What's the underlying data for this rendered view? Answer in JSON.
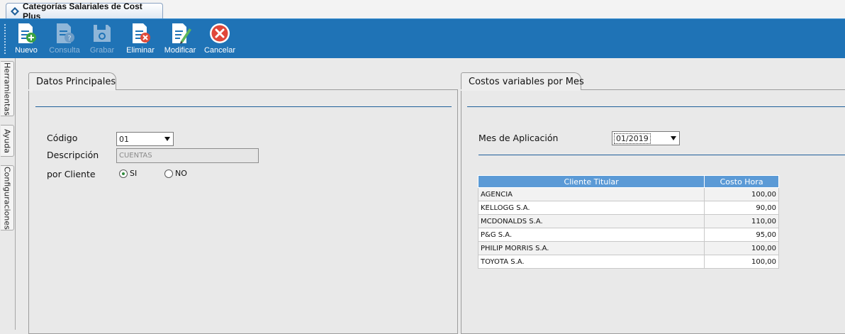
{
  "window_tab": {
    "title": "Categorías Salariales de Cost Plus"
  },
  "toolbar": {
    "buttons": [
      {
        "label": "Nuevo",
        "icon": "document-add-icon",
        "enabled": true
      },
      {
        "label": "Consulta",
        "icon": "document-query-icon",
        "enabled": false
      },
      {
        "label": "Grabar",
        "icon": "save-disk-icon",
        "enabled": false
      },
      {
        "label": "Eliminar",
        "icon": "document-delete-icon",
        "enabled": true
      },
      {
        "label": "Modificar",
        "icon": "document-edit-icon",
        "enabled": true
      },
      {
        "label": "Cancelar",
        "icon": "cancel-circle-icon",
        "enabled": true
      }
    ]
  },
  "side_tabs": [
    "Herramientas",
    "Ayuda",
    "Configuraciones"
  ],
  "datos": {
    "tab_label": "Datos Principales",
    "codigo_label": "Código",
    "codigo_value": "01",
    "descripcion_label": "Descripción",
    "descripcion_value": "CUENTAS",
    "por_cliente_label": "por Cliente",
    "radio_si": "SI",
    "radio_no": "NO",
    "selected": "SI"
  },
  "costos": {
    "tab_label": "Costos variables por Mes",
    "mes_label": "Mes de Aplicación",
    "mes_value": "01/2019",
    "columns": [
      "Cliente Titular",
      "Costo Hora"
    ],
    "rows": [
      {
        "cliente": "AGENCIA",
        "costo": "100,00"
      },
      {
        "cliente": "KELLOGG S.A.",
        "costo": "90,00"
      },
      {
        "cliente": "MCDONALDS S.A.",
        "costo": "110,00"
      },
      {
        "cliente": "P&G S.A.",
        "costo": "95,00"
      },
      {
        "cliente": "PHILIP MORRIS S.A.",
        "costo": "100,00"
      },
      {
        "cliente": "TOYOTA S.A.",
        "costo": "100,00"
      }
    ]
  },
  "colors": {
    "toolbar_bg": "#1f73b6",
    "grid_header": "#5b9ad6",
    "accent_line": "#1f5f9a"
  }
}
